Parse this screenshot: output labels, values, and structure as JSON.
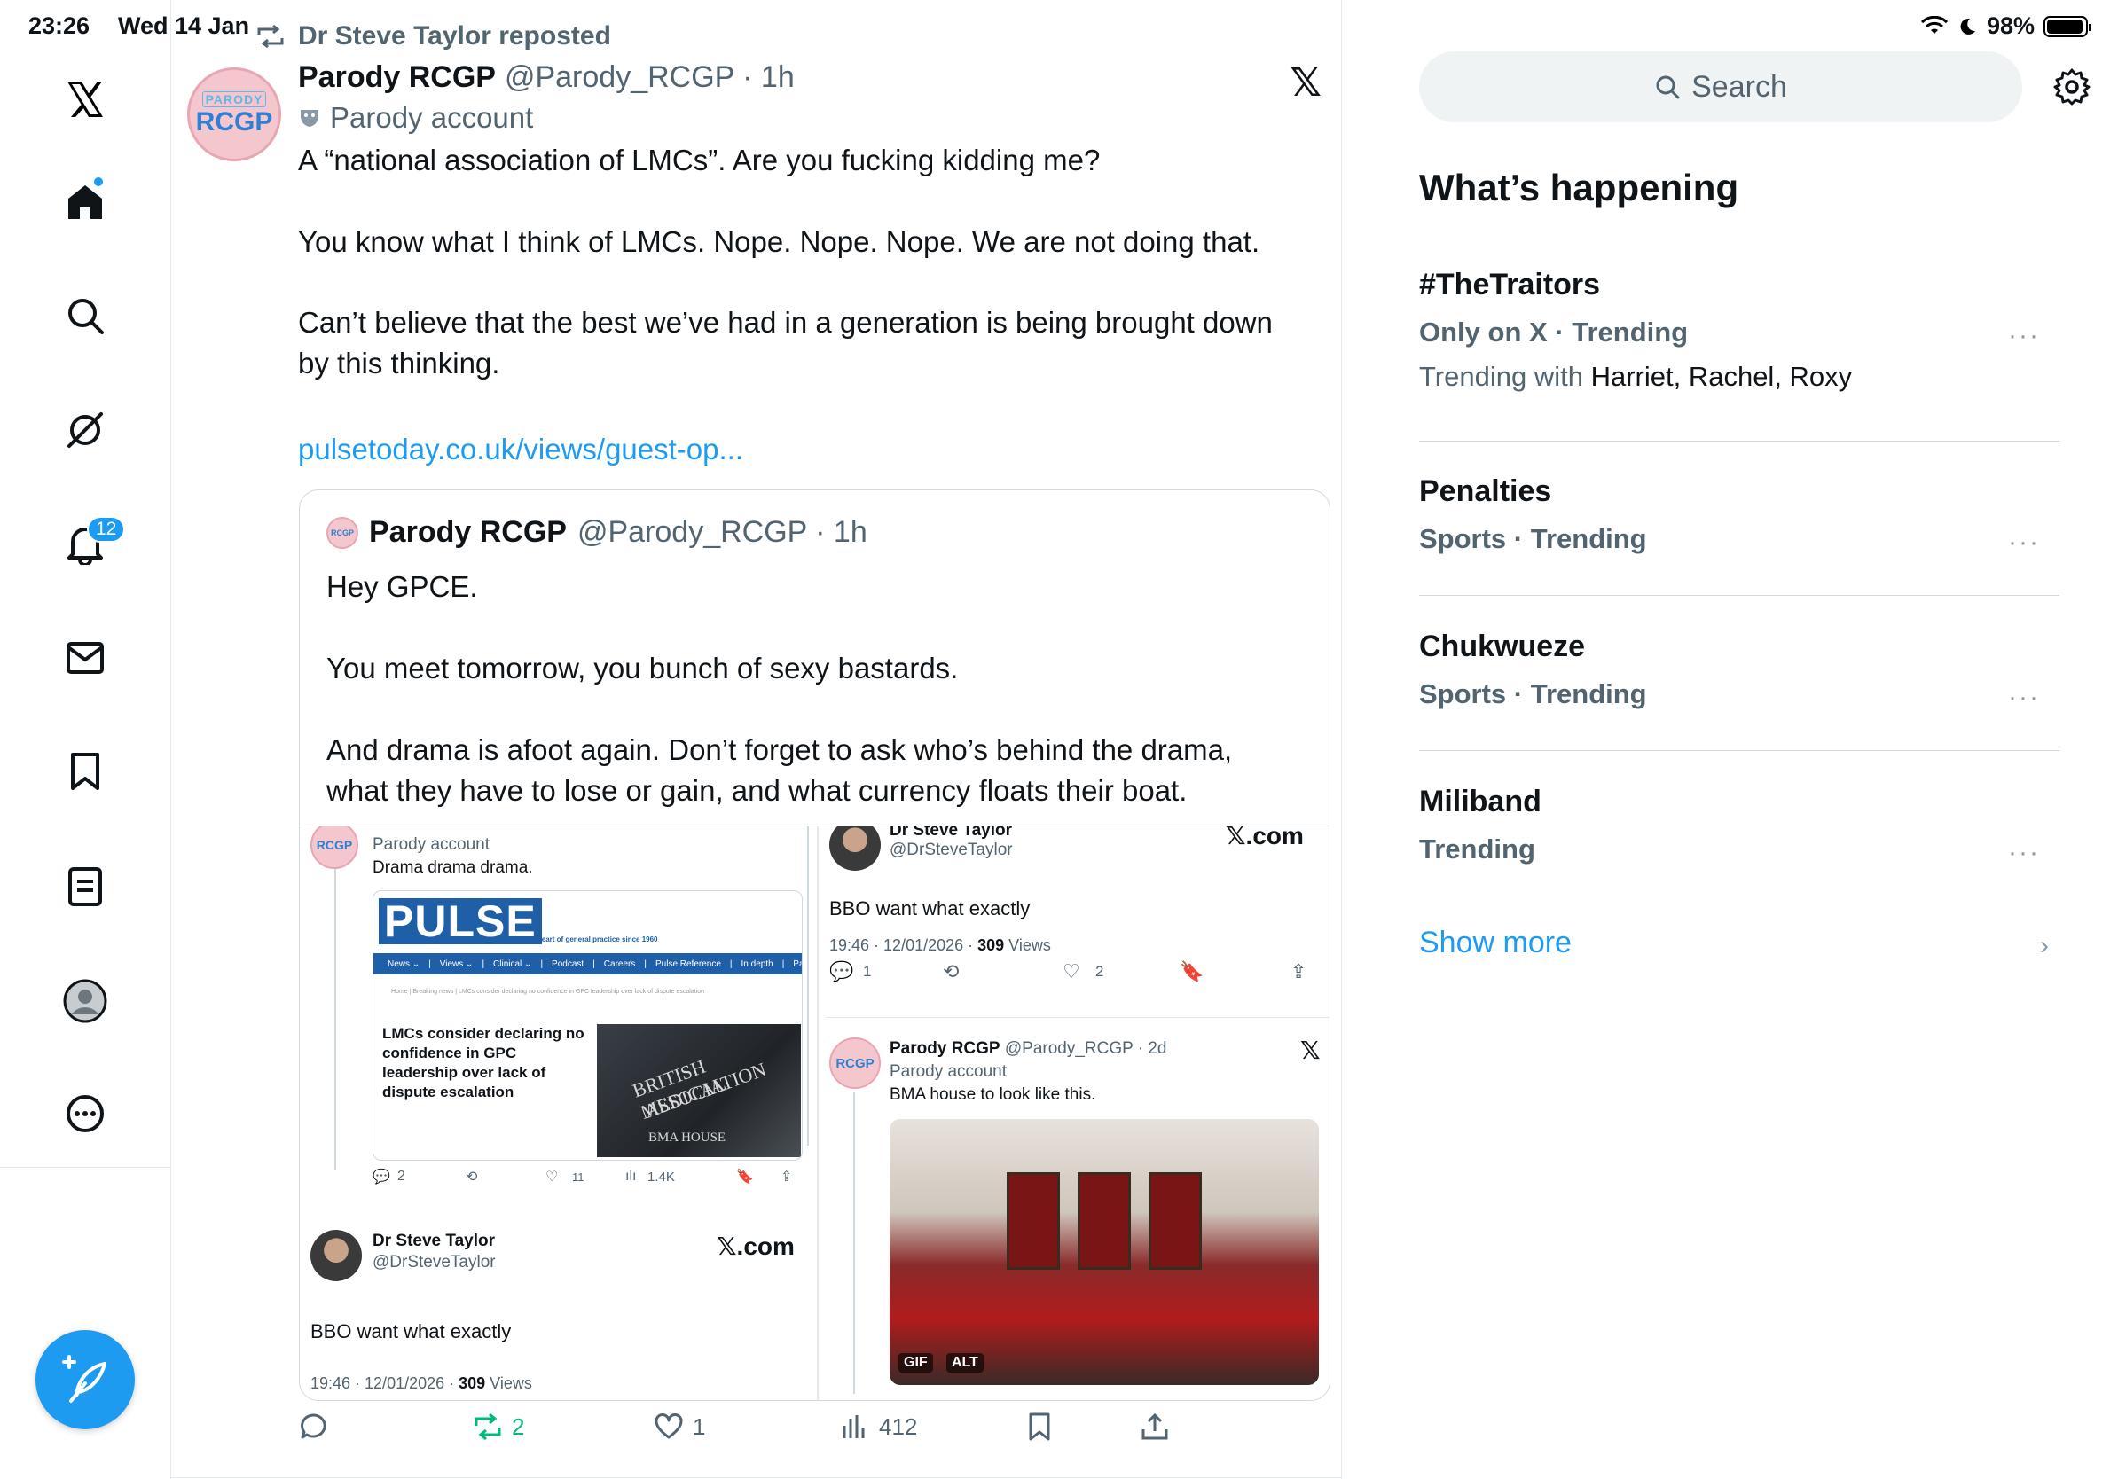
{
  "status_bar": {
    "time": "23:26",
    "date": "Wed 14 Jan",
    "battery": "98%",
    "battery_level": 0.98
  },
  "nav": {
    "notifications_badge": "12",
    "items": [
      "x-logo",
      "home",
      "search",
      "grok",
      "notifications",
      "messages",
      "bookmarks",
      "lists",
      "profile",
      "more"
    ]
  },
  "post": {
    "repost_label": "Dr Steve Taylor reposted",
    "author_name": "Parody RCGP",
    "author_handle": "@Parody_RCGP · 1h",
    "parody_label": "Parody account",
    "avatar_top": "PARODY",
    "avatar_main": "RCGP",
    "brand": "𝕏",
    "text_lines": [
      "A “national association of LMCs”. Are you fucking kidding me?",
      "You know what I think of LMCs. Nope. Nope. Nope. We are not doing that.",
      "Can’t believe that the best we’ve had in a generation is being brought down",
      "by this thinking."
    ],
    "link": "pulsetoday.co.uk/views/guest-op...",
    "quote": {
      "author_name": "Parody RCGP",
      "author_handle": "@Parody_RCGP · 1h",
      "avatar_label": "RCGP",
      "text_lines": [
        "Hey GPCE.",
        "You meet tomorrow, you bunch of sexy bastards.",
        "And drama is afoot again. Don’t forget to ask who’s behind the drama,",
        "what they have to lose or gain, and what currency floats their boat."
      ],
      "image": {
        "left_avatar": "RCGP",
        "left_parody": "Parody account",
        "left_text": "Drama drama drama.",
        "pulse_logo": "PULSE",
        "pulse_tagline": "At the heart of general practice since 1960",
        "pulse_nav": [
          "News ⌄",
          "Views ⌄",
          "Clinical ⌄",
          "Podcast",
          "Careers",
          "Pulse Reference",
          "In depth",
          "Partne"
        ],
        "pulse_crumb": "Home | Breaking news | LMCs consider declaring no confidence in GPC leadership over lack of dispute escalation",
        "pulse_headline": "LMCs consider declaring no confidence in GPC leadership over lack of dispute escalation",
        "photo_text_1": "BRITISH MEDICAL",
        "photo_text_2": "ASSOCIATION",
        "photo_text_3": "BMA HOUSE",
        "left_actions": {
          "replies": "2",
          "likes": "11",
          "views": "1.4K"
        },
        "left_bottom_name": "Dr Steve Taylor",
        "left_bottom_handle": "@DrSteveTaylor",
        "xcom": "𝕏.com",
        "left_bottom_text": "BBO want what exactly",
        "left_bottom_time": "19:46 · 12/01/2026 · ",
        "left_bottom_views_num": "309",
        "left_bottom_views_label": " Views",
        "right_top_name": "Dr Steve Taylor",
        "right_top_handle": "@DrSteveTaylor",
        "right_top_text": "BBO want what exactly",
        "right_top_time": "19:46 · 12/01/2026 · ",
        "right_top_views_num": "309",
        "right_top_views_label": " Views",
        "right_top_actions": {
          "replies": "1",
          "likes": "2"
        },
        "right_post_name": "Parody RCGP",
        "right_post_handle": "@Parody_RCGP · 2d",
        "right_post_parody": "Parody account",
        "right_post_text": "BMA house to look like this.",
        "gif_label": "GIF",
        "alt_label": "ALT"
      }
    },
    "actions": {
      "replies": "",
      "reposts": "2",
      "likes": "1",
      "views": "412"
    }
  },
  "sidebar": {
    "search_placeholder": "Search",
    "heading": "What’s happening",
    "trends": [
      {
        "title": "#TheTraitors",
        "meta": "Only on X · Trending",
        "with_prefix": "Trending with",
        "with_names": "Harriet, Rachel, Roxy"
      },
      {
        "title": "Penalties",
        "meta": "Sports · Trending"
      },
      {
        "title": "Chukwueze",
        "meta": "Sports · Trending"
      },
      {
        "title": "Miliband",
        "meta": "Trending"
      }
    ],
    "more_label": "···",
    "show_more": "Show more"
  },
  "colors": {
    "accent": "#1d9bf0",
    "repost_green": "#00ba7c",
    "text_secondary": "#536471",
    "pulse_blue": "#1f5fa8"
  }
}
